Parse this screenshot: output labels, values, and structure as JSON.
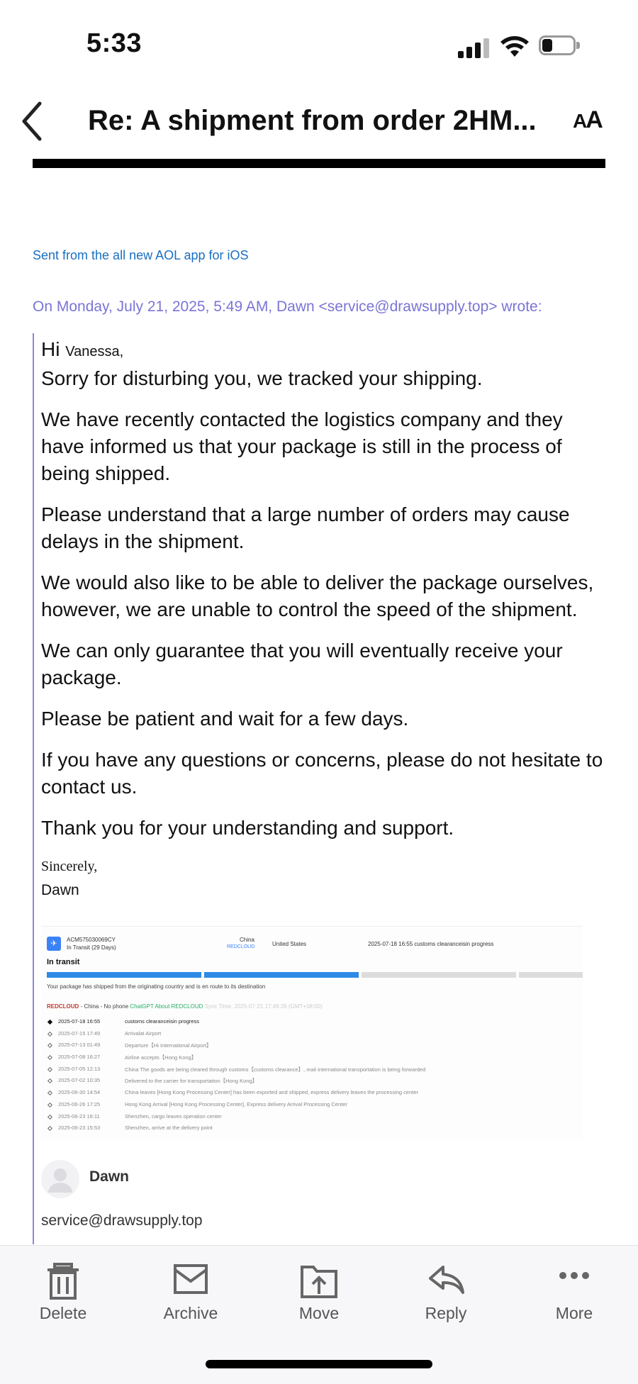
{
  "status_bar": {
    "time": "5:33",
    "battery_level": 0.2
  },
  "header": {
    "title": "Re: A shipment from order 2HM...",
    "text_size_label_big": "A",
    "text_size_label_small": "A"
  },
  "email": {
    "sent_from": "Sent from the all new AOL app for iOS",
    "quote_header": "On Monday, July 21, 2025, 5:49 AM, Dawn <service@drawsupply.top> wrote:",
    "greeting_hi": "Hi",
    "greeting_name": "Vanessa,",
    "paragraphs": [
      "Sorry for disturbing you, we tracked your shipping.",
      "We have recently contacted the logistics company and they have informed us that your package is still in the process of being shipped.",
      "Please understand that a large number of orders may cause delays in the shipment.",
      "We would also like to be able to deliver the package ourselves, however, we are unable to control the speed of the shipment.",
      "We can only guarantee that you will eventually receive your package.",
      "Please be patient and wait for a few days.",
      "If you have any questions or concerns, please do not hesitate to contact us.",
      "Thank you for your understanding and support."
    ],
    "sign_off": "Sincerely,",
    "sign_name": "Dawn"
  },
  "tracking": {
    "number": "ACM575030069CY",
    "status": "In Transit (29 Days)",
    "origin": "China",
    "carrier_small": "REDCLOUD",
    "destination": "United States",
    "latest": "2025-07-18 16:55  customs clearanceisin progress",
    "heading": "In transit",
    "progress_fraction": 0.5,
    "note": "Your package has shipped from the originating country and is en route to its destination",
    "carrier_name": "REDCLOUD",
    "carrier_info": "- China - No phone",
    "carrier_link": "ChatGPT About REDCLOUD",
    "carrier_time": "Sync Time: 2025-07-21 17:49:26 (GMT+08:00)",
    "events": [
      {
        "time": "2025-07-18 16:55",
        "desc": "customs clearanceisin progress"
      },
      {
        "time": "2025-07-15 17:49",
        "desc": "Arrivalat Airport"
      },
      {
        "time": "2025-07-13 01:49",
        "desc": "Departure【Hi International Airport】"
      },
      {
        "time": "2025-07-08 16:27",
        "desc": "Airline accepts【Hong Kong】"
      },
      {
        "time": "2025-07-05 12:13",
        "desc": "China The goods are being cleared through customs【customs clearance】, mail international transportation is being forwarded"
      },
      {
        "time": "2025-07-02 10:35",
        "desc": "Delivered to the carrier for transportation【Hong Kong】"
      },
      {
        "time": "2025-06-30 14:54",
        "desc": "China leaves [Hong Kong Processing Center] has been exported and shipped, express delivery leaves the processing center"
      },
      {
        "time": "2025-06-26 17:25",
        "desc": "Hong Kong Arrival [Hong Kong Processing Center], Express delivery Arrival Processing Center"
      },
      {
        "time": "2025-06-23 16:11",
        "desc": "Shenzhen, cargo leaves operation center"
      },
      {
        "time": "2025-06-23 15:53",
        "desc": "Shenzhen, arrive at the delivery point"
      }
    ]
  },
  "sender": {
    "name": "Dawn",
    "email": "service@drawsupply.top"
  },
  "toolbar": {
    "delete": "Delete",
    "archive": "Archive",
    "move": "Move",
    "reply": "Reply",
    "more": "More"
  },
  "colors": {
    "link": "#1a6fc1",
    "quote": "#7b74d6",
    "progress": "#2d8ae6"
  }
}
